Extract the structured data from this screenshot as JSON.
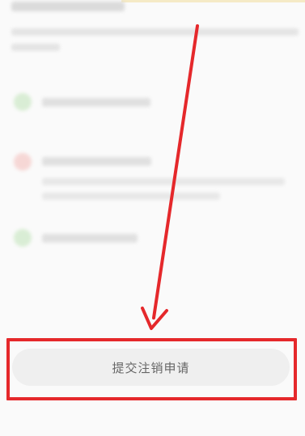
{
  "submit_button": {
    "label": "提交注销申请"
  },
  "colors": {
    "annotation_red": "#e5282b",
    "button_bg": "#efefef",
    "button_text": "#666666",
    "check_green": "#d6ecd1",
    "warn_red": "#f6d4d2"
  },
  "icons": [
    "check-icon",
    "warning-icon",
    "arrow-annotation"
  ]
}
